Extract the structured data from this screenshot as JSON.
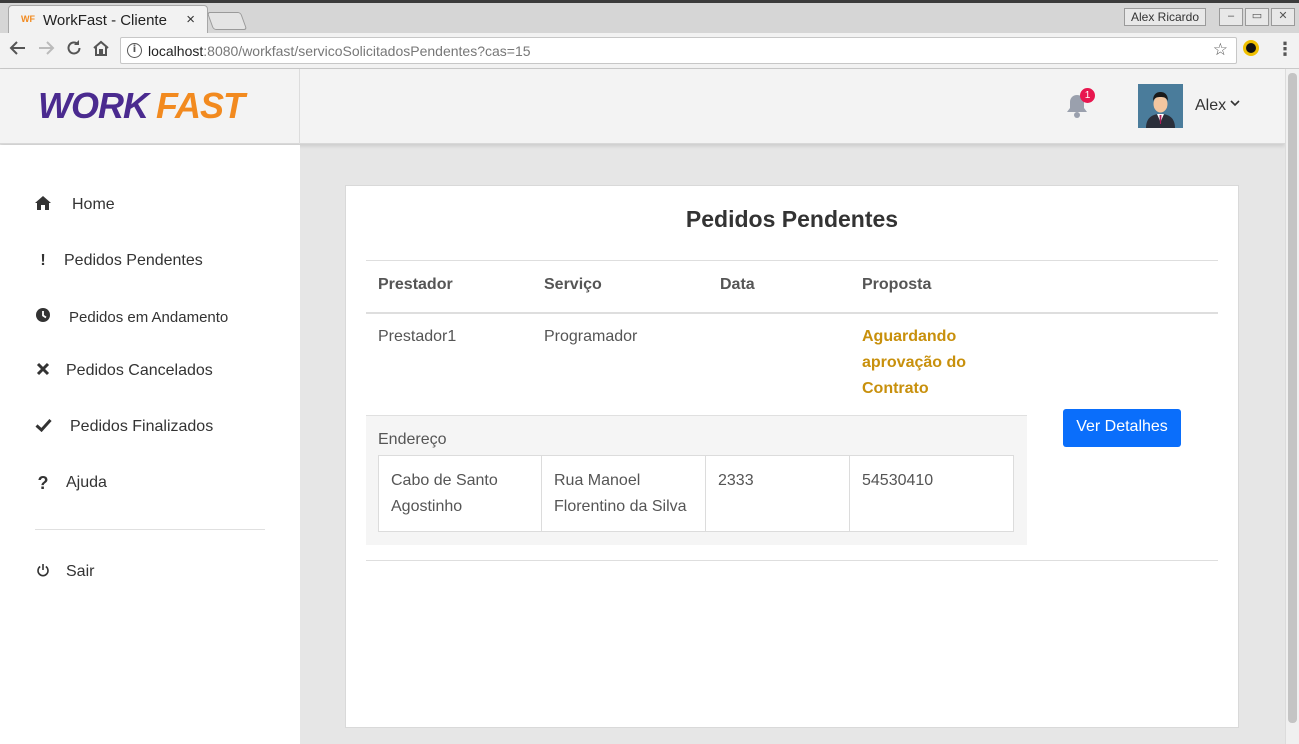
{
  "browser": {
    "tab_title": "WorkFast - Cliente",
    "tab_close": "×",
    "favicon_text": "WF",
    "window_user": "Alex Ricardo",
    "window_buttons": [
      "–",
      "▭",
      "✕"
    ],
    "url_host": "localhost",
    "url_path": ":8080/workfast/servicoSolicitadosPendentes?cas=15",
    "nav_icons": [
      "back-arrow-icon",
      "forward-arrow-icon",
      "reload-icon",
      "home-icon"
    ]
  },
  "header": {
    "logo_part1": "WORK",
    "logo_part2": "FAST",
    "notification_count": "1",
    "user_name": "Alex",
    "colors": {
      "logo_purple": "#4a2a8f",
      "logo_orange": "#f28a1f",
      "badge": "#e8174f"
    }
  },
  "sidebar": {
    "items": [
      {
        "label": "Home",
        "icon": "home-icon"
      },
      {
        "label": "Pedidos Pendentes",
        "icon": "exclamation-icon"
      },
      {
        "label": "Pedidos em Andamento",
        "icon": "clock-icon"
      },
      {
        "label": "Pedidos Cancelados",
        "icon": "x-icon"
      },
      {
        "label": "Pedidos Finalizados",
        "icon": "check-icon"
      },
      {
        "label": "Ajuda",
        "icon": "question-icon"
      }
    ],
    "logout": {
      "label": "Sair",
      "icon": "power-icon"
    }
  },
  "main": {
    "title": "Pedidos Pendentes",
    "columns": [
      "Prestador",
      "Serviço",
      "Data",
      "Proposta"
    ],
    "row": {
      "prestador": "Prestador1",
      "servico": "Programador",
      "data": "",
      "proposta_lines": [
        "Aguardando",
        "aprovação do",
        "Contrato"
      ]
    },
    "address": {
      "label": "Endereço",
      "cells": [
        [
          "Cabo de Santo",
          "Agostinho"
        ],
        [
          "Rua Manoel",
          "Florentino da Silva"
        ],
        [
          "2333"
        ],
        [
          "54530410"
        ]
      ]
    },
    "details_button": "Ver Detalhes",
    "colors": {
      "status": "#c8900c",
      "button": "#0a6efb"
    }
  }
}
